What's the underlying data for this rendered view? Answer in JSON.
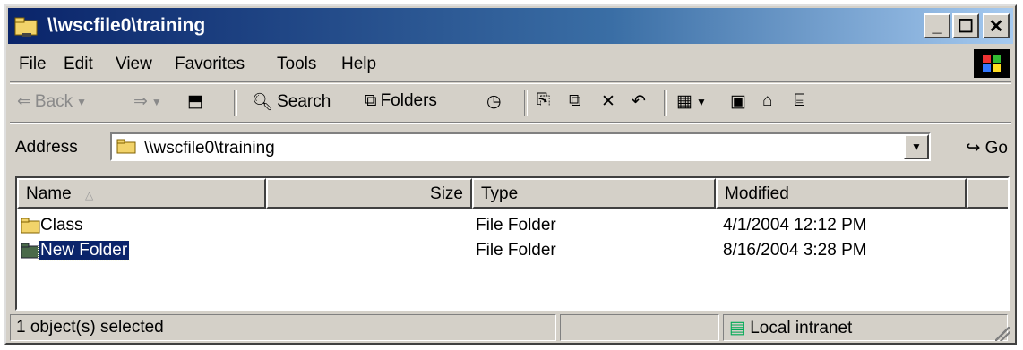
{
  "window": {
    "title": "\\\\wscfile0\\training",
    "minimize": "_",
    "maximize": "☐",
    "close": "✕"
  },
  "menubar": {
    "items": [
      "File",
      "Edit",
      "View",
      "Favorites",
      "Tools",
      "Help"
    ]
  },
  "toolbar": {
    "back": "Back",
    "search": "Search",
    "folders": "Folders"
  },
  "address": {
    "label": "Address",
    "value": "\\\\wscfile0\\training",
    "go": "Go"
  },
  "list": {
    "columns": [
      "Name",
      "Size",
      "Type",
      "Modified"
    ],
    "rows": [
      {
        "name": "Class",
        "size": "",
        "type": "File Folder",
        "modified": "4/1/2004 12:12 PM",
        "selected": false
      },
      {
        "name": "New Folder",
        "size": "",
        "type": "File Folder",
        "modified": "8/16/2004 3:28 PM",
        "selected": true
      }
    ]
  },
  "status": {
    "message": "1 object(s) selected",
    "zone": "Local intranet"
  },
  "colors": {
    "title_start": "#0a246a",
    "title_end": "#a6caf0",
    "face": "#d4d0c8",
    "selection": "#0a246a",
    "folder": "#f2d36a"
  }
}
